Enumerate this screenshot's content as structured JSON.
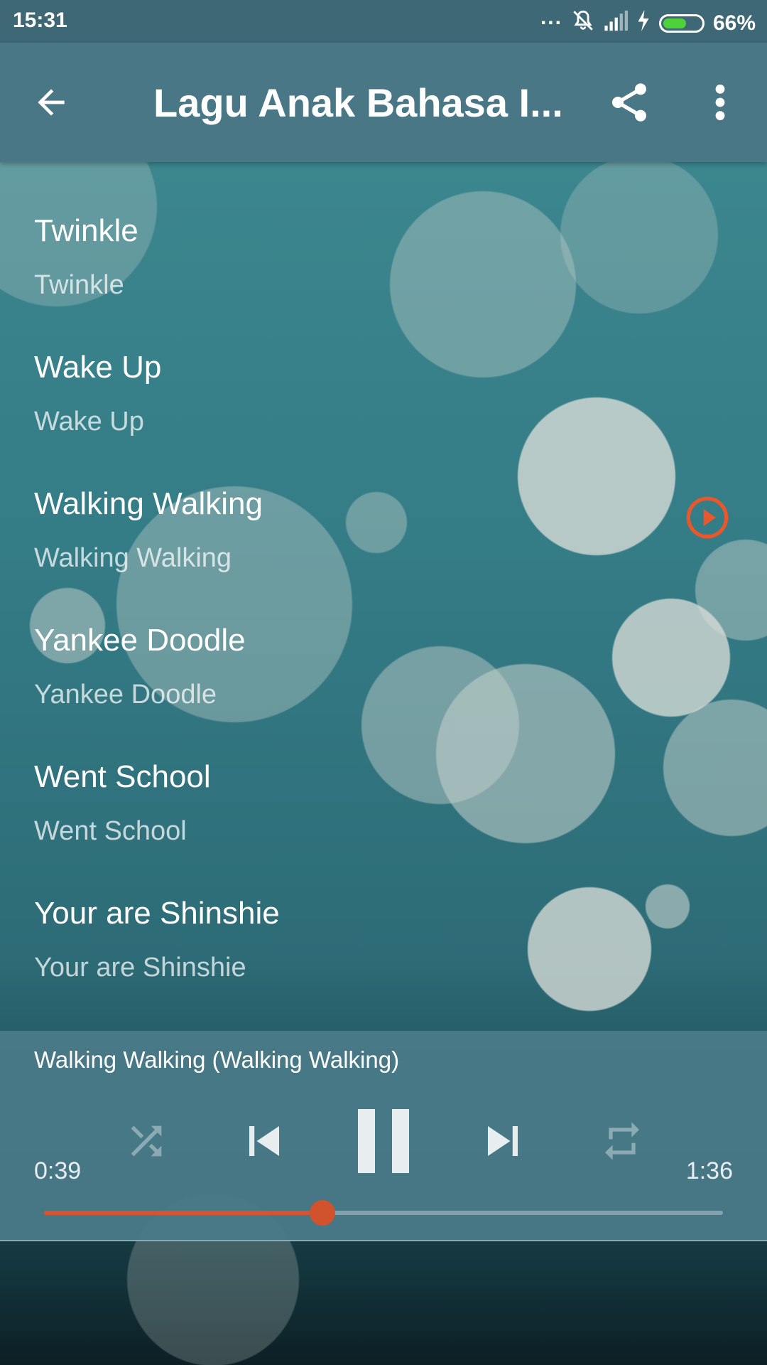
{
  "status_bar": {
    "time": "15:31",
    "dots": "...",
    "battery_text": "66%",
    "battery_level": 0.66,
    "icons": [
      "mute-icon",
      "signal-icon",
      "charging-icon",
      "battery-icon"
    ]
  },
  "app_bar": {
    "title": "Lagu Anak Bahasa I...",
    "icons": [
      "back-arrow-icon",
      "share-icon",
      "more-vert-icon"
    ]
  },
  "songs": [
    {
      "title": "Twinkle",
      "subtitle": "Twinkle",
      "playing": false
    },
    {
      "title": "Wake Up",
      "subtitle": "Wake Up",
      "playing": false
    },
    {
      "title": "Walking Walking",
      "subtitle": "Walking Walking",
      "playing": true
    },
    {
      "title": "Yankee Doodle",
      "subtitle": "Yankee Doodle",
      "playing": false
    },
    {
      "title": "Went School",
      "subtitle": "Went School",
      "playing": false
    },
    {
      "title": "Your are Shinshie",
      "subtitle": "Your are Shinshie",
      "playing": false
    }
  ],
  "player": {
    "now_playing": "Walking Walking (Walking Walking)",
    "elapsed": "0:39",
    "duration": "1:36",
    "progress": 0.41,
    "controls": [
      "shuffle-icon",
      "skip-previous-icon",
      "pause-icon",
      "skip-next-icon",
      "repeat-icon"
    ]
  },
  "colors": {
    "accent": "#d9532e",
    "app_bar": "#4a7786",
    "status_bar": "#3e6876",
    "battery": "#4fd13a"
  }
}
